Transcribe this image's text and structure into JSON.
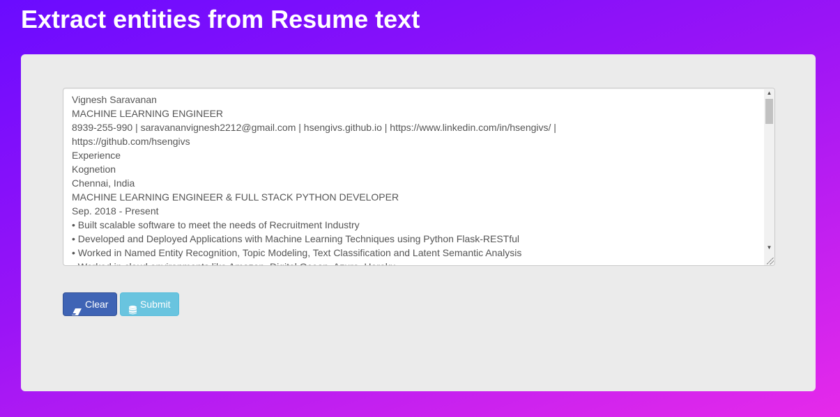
{
  "header": {
    "title": "Extract entities from Resume text"
  },
  "resume": {
    "text": "Vignesh Saravanan\nMACHINE LEARNING ENGINEER\n8939-255-990 | saravananvignesh2212@gmail.com | hsengivs.github.io | https://www.linkedin.com/in/hsengivs/ |\nhttps://github.com/hsengivs\nExperience\nKognetion\nChennai, India\nMACHINE LEARNING ENGINEER & FULL STACK PYTHON DEVELOPER\nSep. 2018 - Present\n• Built scalable software to meet the needs of Recruitment Industry\n• Developed and Deployed Applications with Machine Learning Techniques using Python Flask-RESTful\n• Worked in Named Entity Recognition, Topic Modeling, Text Classification and Latent Semantic Analysis\n• Worked in cloud environments like Amazon, Digital Ocean, Azure, Heroku"
  },
  "actions": {
    "clear_label": "Clear",
    "submit_label": "Submit"
  },
  "icons": {
    "clear": "eraser-icon",
    "submit": "database-icon"
  },
  "colors": {
    "clear_button": "#3f64b5",
    "submit_button": "#5bc0de",
    "panel": "#ebebeb"
  }
}
